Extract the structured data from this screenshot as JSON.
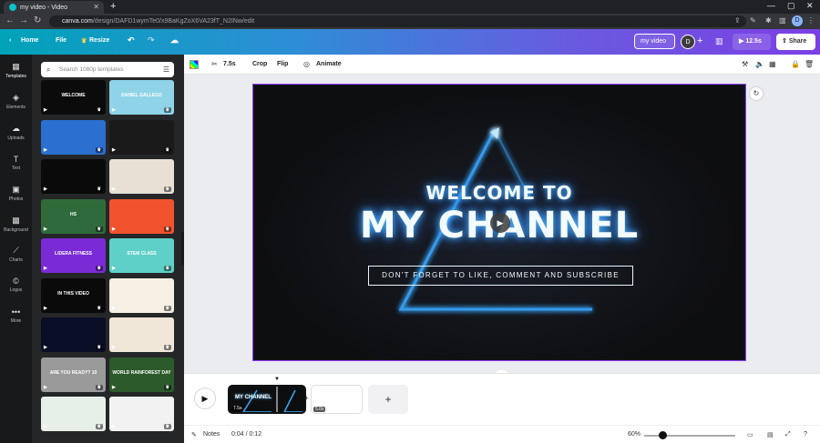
{
  "browser": {
    "tab_title": "my video - Video",
    "url_domain": "canva.com",
    "url_path": "/design/DAFD1wymTe0/x9BaKgZoX6VA23fT_N2INw/edit",
    "profile_initial": "D"
  },
  "header": {
    "home": "Home",
    "file": "File",
    "resize": "Resize",
    "title": "my video",
    "avatar": "D",
    "duration": "12.5s",
    "share": "Share"
  },
  "rail": [
    {
      "label": "Templates",
      "icon": "templates-icon"
    },
    {
      "label": "Elements",
      "icon": "elements-icon"
    },
    {
      "label": "Uploads",
      "icon": "uploads-icon"
    },
    {
      "label": "Text",
      "icon": "text-icon"
    },
    {
      "label": "Photos",
      "icon": "photos-icon"
    },
    {
      "label": "Background",
      "icon": "background-icon"
    },
    {
      "label": "Charts",
      "icon": "charts-icon"
    },
    {
      "label": "Logos",
      "icon": "logos-icon"
    },
    {
      "label": "More",
      "icon": "more-icon"
    }
  ],
  "panel": {
    "search_placeholder": "Search 1080p templates",
    "thumbs": [
      {
        "text": "WELCOME",
        "bg": "#0b0b0b"
      },
      {
        "text": "DANIEL GALLEGO",
        "bg": "#8fd3e8"
      },
      {
        "text": "",
        "bg": "#2b6fd0"
      },
      {
        "text": "",
        "bg": "#1a1a1a"
      },
      {
        "text": "",
        "bg": "#0a0a0a"
      },
      {
        "text": "",
        "bg": "#e8e0d4"
      },
      {
        "text": "HS",
        "bg": "#2f6b3a"
      },
      {
        "text": "",
        "bg": "#f0532e"
      },
      {
        "text": "LIDERA FITNESS",
        "bg": "#7a2bd6"
      },
      {
        "text": "STEM CLASS",
        "bg": "#5fd0c8"
      },
      {
        "text": "IN THIS VIDEO",
        "bg": "#0a0a0a"
      },
      {
        "text": "",
        "bg": "#f6efe4"
      },
      {
        "text": "",
        "bg": "#0a0d26"
      },
      {
        "text": "",
        "bg": "#f1e7d8"
      },
      {
        "text": "ARE YOU READY? 10",
        "bg": "#9a9a9a"
      },
      {
        "text": "WORLD RAINFOREST DAY",
        "bg": "#2d5a2a"
      },
      {
        "text": "",
        "bg": "#e6efe8"
      },
      {
        "text": "",
        "bg": "#f2f2f2"
      }
    ]
  },
  "toolbar": {
    "duration": "7.5s",
    "crop": "Crop",
    "flip": "Flip",
    "animate": "Animate"
  },
  "design": {
    "line1": "WELCOME TO",
    "line2": "MY CHANNEL",
    "subtitle": "DON'T FORGET TO LIKE, COMMENT AND SUBSCRIBE"
  },
  "timeline": {
    "clip1_duration": "7.5s",
    "clip2_duration": "5.0s",
    "clip1_text": "MY CHANNEL"
  },
  "footer": {
    "notes": "Notes",
    "time": "0:04 / 0:12",
    "zoom": "60%"
  }
}
